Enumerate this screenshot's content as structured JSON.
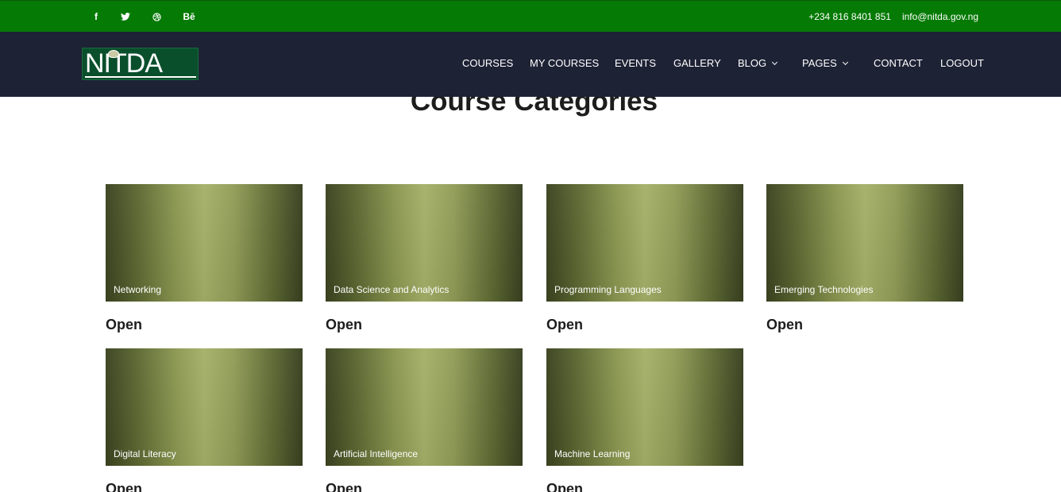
{
  "topbar": {
    "social": [
      {
        "icon": "facebook-icon",
        "glyph": "f"
      },
      {
        "icon": "twitter-icon",
        "glyph": ""
      },
      {
        "icon": "dribbble-icon",
        "glyph": ""
      },
      {
        "icon": "behance-icon",
        "glyph": "Bē"
      }
    ],
    "phone": "+234 816 8401 851",
    "email": "info@nitda.gov.ng"
  },
  "nav": {
    "logo_text": "NITDA",
    "items": [
      {
        "label": "COURSES"
      },
      {
        "label": "MY COURSES"
      },
      {
        "label": "EVENTS"
      },
      {
        "label": "GALLERY"
      },
      {
        "label": "BLOG"
      },
      {
        "label": "PAGES"
      },
      {
        "label": "CONTACT"
      },
      {
        "label": "LOGOUT"
      }
    ]
  },
  "main": {
    "title": "Course Categories",
    "categories": [
      {
        "name": "Networking",
        "status": "Open"
      },
      {
        "name": "Data Science and Analytics",
        "status": "Open"
      },
      {
        "name": "Programming Languages",
        "status": "Open"
      },
      {
        "name": "Emerging Technologies",
        "status": "Open"
      },
      {
        "name": "Digital Literacy",
        "status": "Open"
      },
      {
        "name": "Artificial Intelligence",
        "status": "Open"
      },
      {
        "name": "Machine Learning",
        "status": "Open"
      }
    ]
  },
  "colors": {
    "topbar": "#057a05",
    "navbar": "#1e2235",
    "logo_bg": "#0a4f2c",
    "card_light": "#a5b169",
    "card_dark": "#384020"
  }
}
